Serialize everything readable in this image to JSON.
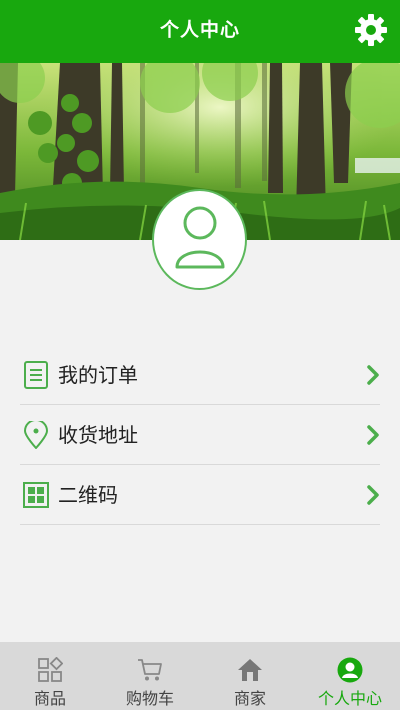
{
  "header": {
    "title": "个人中心",
    "settings_icon": "gear-icon"
  },
  "banner": {
    "image": "forest-photo"
  },
  "profile": {
    "avatar_icon": "user-icon"
  },
  "menu": {
    "items": [
      {
        "label": "我的订单",
        "icon": "document-list-icon"
      },
      {
        "label": "收货地址",
        "icon": "location-pin-icon"
      },
      {
        "label": "二维码",
        "icon": "qr-code-icon"
      }
    ]
  },
  "tabbar": {
    "tabs": [
      {
        "label": "商品",
        "icon": "grid-icon",
        "active": false
      },
      {
        "label": "购物车",
        "icon": "cart-icon",
        "active": false
      },
      {
        "label": "商家",
        "icon": "home-icon",
        "active": false
      },
      {
        "label": "个人中心",
        "icon": "profile-icon",
        "active": true
      }
    ]
  },
  "colors": {
    "primary": "#18a80e",
    "accent": "#5cb85c",
    "tabbar_bg": "#d9d9d9",
    "page_bg": "#f2f2f2"
  }
}
